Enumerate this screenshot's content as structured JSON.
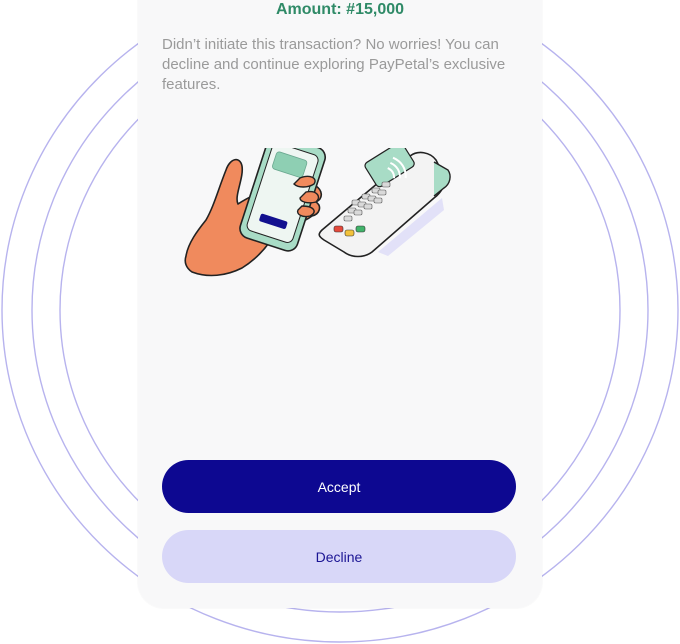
{
  "transaction": {
    "amount_label": "Amount: #15,000",
    "message": "Didn’t initiate this transaction? No worries! You can decline and continue exploring PayPetal’s exclusive features."
  },
  "actions": {
    "accept_label": "Accept",
    "decline_label": "Decline"
  },
  "colors": {
    "amount_green": "#2f8a67",
    "primary_navy": "#0d0891",
    "secondary_lavender": "#d8d7f8",
    "ring_lavender": "#b7b3ee",
    "hand_orange": "#f08a5d",
    "phone_mint": "#a8dcc6"
  },
  "illustration": {
    "hand_icon": "hand-holding-phone-icon",
    "terminal_icon": "pos-terminal-icon",
    "contactless_icon": "contactless-icon"
  }
}
